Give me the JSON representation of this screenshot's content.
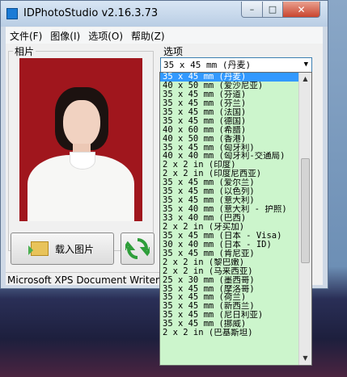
{
  "window": {
    "title": "IDPhotoStudio v2.16.3.73",
    "controls": {
      "minimize": "–",
      "maximize": "□",
      "close": "✕"
    }
  },
  "menu": [
    "文件(F)",
    "图像(I)",
    "选项(O)",
    "帮助(Z)"
  ],
  "photo_group": {
    "label": "相片"
  },
  "buttons": {
    "load": "载入图片"
  },
  "status": {
    "printer": "Microsoft XPS Document Writer"
  },
  "options": {
    "label": "选项",
    "selected": "35 x 45 mm (丹麦)",
    "items": [
      "35 x 45 mm (丹麦)",
      "40 x 50 mm (爱沙尼亚)",
      "35 x 45 mm (芬道)",
      "35 x 45 mm (芬兰)",
      "35 x 45 mm (法国)",
      "35 x 45 mm (德国)",
      "40 x 60 mm (希腊)",
      "40 x 50 mm (香港)",
      "35 x 45 mm (匈牙利)",
      "40 x 40 mm (匈牙利-交通局)",
      "2 x 2 in (印度)",
      "2 x 2 in (印度尼西亚)",
      "35 x 45 mm (爱尔兰)",
      "35 x 45 mm (以色列)",
      "35 x 45 mm (意大利)",
      "35 x 40 mm (意大利 - 护照)",
      "33 x 40 mm (巴西)",
      "2 x 2 in (牙买加)",
      "35 x 45 mm (日本 - Visa)",
      "30 x 40 mm (日本 - ID)",
      "35 x 45 mm (肯尼亚)",
      "2 x 2 in (黎巴嫩)",
      "2 x 2 in (马来西亚)",
      "25 x 30 mm (墨西哥)",
      "35 x 45 mm (摩洛哥)",
      "35 x 45 mm (荷兰)",
      "35 x 45 mm (新西兰)",
      "35 x 45 mm (尼日利亚)",
      "35 x 45 mm (挪威)",
      "2 x 2 in (巴基斯坦)"
    ],
    "selected_index": 0
  },
  "colors": {
    "list_bg": "#ccf5cc",
    "selection": "#3399ff",
    "photo_bg": "#a0161d"
  }
}
